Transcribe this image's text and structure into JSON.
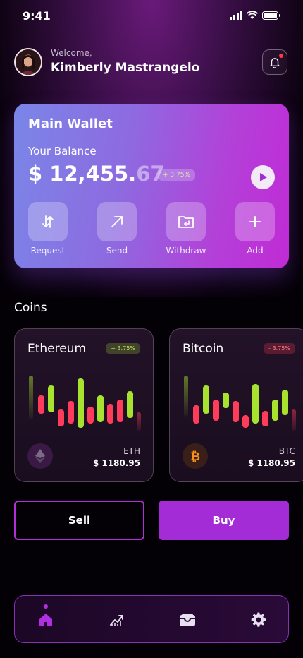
{
  "status_bar": {
    "time": "9:41"
  },
  "header": {
    "welcome": "Welcome,",
    "username": "Kimberly Mastrangelo"
  },
  "wallet": {
    "title": "Main Wallet",
    "subtitle": "Your Balance",
    "balance_main": "$ 12,455.",
    "balance_cents": "67",
    "change": "+ 3.75%",
    "actions": [
      {
        "label": "Request",
        "icon": "request-arrow-icon"
      },
      {
        "label": "Send",
        "icon": "send-arrow-icon"
      },
      {
        "label": "Withdraw",
        "icon": "folder-withdraw-icon"
      },
      {
        "label": "Add",
        "icon": "plus-icon"
      }
    ]
  },
  "coins": {
    "title": "Coins",
    "items": [
      {
        "name": "Ethereum",
        "change": "+ 3.75%",
        "trend": "up",
        "symbol": "ETH",
        "price": "$ 1180.95",
        "icon": "ethereum-icon"
      },
      {
        "name": "Bitcoin",
        "change": "- 3.75%",
        "trend": "down",
        "symbol": "BTC",
        "price": "$ 1180.95",
        "icon": "bitcoin-icon"
      }
    ]
  },
  "trade": {
    "sell_label": "Sell",
    "buy_label": "Buy"
  },
  "nav": {
    "items": [
      "home-icon",
      "chart-trend-icon",
      "wallet-icon",
      "settings-gear-icon"
    ],
    "active": "home-icon"
  },
  "colors": {
    "accent": "#a42cd6",
    "positive": "#a6e22e",
    "negative": "#ff3d5a"
  }
}
